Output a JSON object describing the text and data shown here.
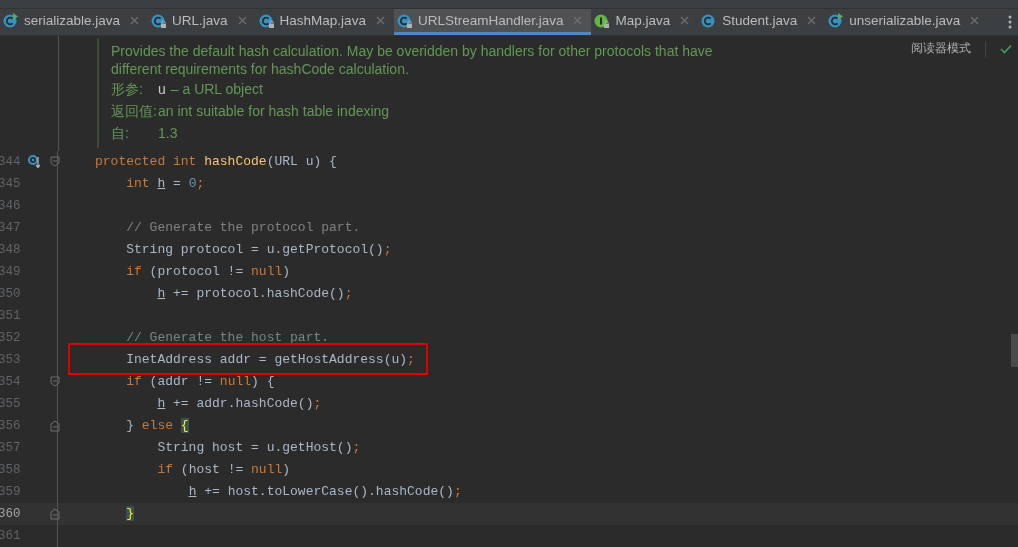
{
  "tabs": [
    {
      "label": "serializable.java",
      "kind": "runnable",
      "selected": false
    },
    {
      "label": "URL.java",
      "kind": "locked",
      "selected": false
    },
    {
      "label": "HashMap.java",
      "kind": "locked",
      "selected": false
    },
    {
      "label": "URLStreamHandler.java",
      "kind": "locked",
      "selected": true
    },
    {
      "label": "Map.java",
      "kind": "interface",
      "selected": false
    },
    {
      "label": "Student.java",
      "kind": "class",
      "selected": false
    },
    {
      "label": "unserializable.java",
      "kind": "runnable",
      "selected": false
    }
  ],
  "doc": {
    "description": [
      "Provides the default hash calculation. May be overidden by handlers for other protocols that have",
      "different requirements for hashCode calculation."
    ],
    "tags": [
      {
        "label": "形参:",
        "name": "u",
        "text": "– a URL object"
      },
      {
        "label": "返回值:",
        "text": "an int suitable for hash table indexing"
      },
      {
        "label": "自:",
        "text": "1.3"
      }
    ],
    "reader_mode": "阅读器模式"
  },
  "lines": [
    {
      "number": "344",
      "overrides": true,
      "fold_start": true,
      "fold_end": false,
      "current": false,
      "highlighted": false,
      "tokens": [
        {
          "kind": "keyword",
          "text": "protected int "
        },
        {
          "kind": "method",
          "text": "hashCode"
        },
        {
          "kind": "plain",
          "text": "(URL u) {"
        }
      ]
    },
    {
      "number": "345",
      "overrides": false,
      "fold_start": false,
      "fold_end": false,
      "current": false,
      "highlighted": false,
      "tokens": [
        {
          "kind": "keyword",
          "text": "    int "
        },
        {
          "kind": "local",
          "text": "h"
        },
        {
          "kind": "plain",
          "text": " = "
        },
        {
          "kind": "number",
          "text": "0"
        },
        {
          "kind": "punct",
          "text": ";"
        }
      ]
    },
    {
      "number": "346",
      "overrides": false,
      "fold_start": false,
      "fold_end": false,
      "current": false,
      "highlighted": false
    },
    {
      "number": "347",
      "overrides": false,
      "fold_start": false,
      "fold_end": false,
      "current": false,
      "highlighted": false,
      "tokens": [
        {
          "kind": "comment",
          "text": "    // Generate the protocol part."
        }
      ]
    },
    {
      "number": "348",
      "overrides": false,
      "fold_start": false,
      "fold_end": false,
      "current": false,
      "highlighted": false,
      "tokens": [
        {
          "kind": "plain",
          "text": "    String protocol = u.getProtocol()"
        },
        {
          "kind": "punct",
          "text": ";"
        }
      ]
    },
    {
      "number": "349",
      "overrides": false,
      "fold_start": false,
      "fold_end": false,
      "current": false,
      "highlighted": false,
      "tokens": [
        {
          "kind": "keyword",
          "text": "    if "
        },
        {
          "kind": "plain",
          "text": "(protocol != "
        },
        {
          "kind": "keyword",
          "text": "null"
        },
        {
          "kind": "plain",
          "text": ")"
        }
      ]
    },
    {
      "number": "350",
      "overrides": false,
      "fold_start": false,
      "fold_end": false,
      "current": false,
      "highlighted": false,
      "tokens": [
        {
          "kind": "local",
          "text": "        h"
        },
        {
          "kind": "plain",
          "text": " += protocol.hashCode()"
        },
        {
          "kind": "punct",
          "text": ";"
        }
      ]
    },
    {
      "number": "351",
      "overrides": false,
      "fold_start": false,
      "fold_end": false,
      "current": false,
      "highlighted": false
    },
    {
      "number": "352",
      "overrides": false,
      "fold_start": false,
      "fold_end": false,
      "current": false,
      "highlighted": false,
      "tokens": [
        {
          "kind": "comment",
          "text": "    // Generate the host part."
        }
      ]
    },
    {
      "number": "353",
      "overrides": false,
      "fold_start": false,
      "fold_end": false,
      "current": false,
      "highlighted": true,
      "tokens": [
        {
          "kind": "plain",
          "text": "    InetAddress addr = getHostAddress(u)"
        },
        {
          "kind": "punct",
          "text": ";"
        }
      ]
    },
    {
      "number": "354",
      "overrides": false,
      "fold_start": true,
      "fold_end": false,
      "current": false,
      "highlighted": false,
      "tokens": [
        {
          "kind": "keyword",
          "text": "    if "
        },
        {
          "kind": "plain",
          "text": "(addr != "
        },
        {
          "kind": "keyword",
          "text": "null"
        },
        {
          "kind": "plain",
          "text": ") {"
        }
      ]
    },
    {
      "number": "355",
      "overrides": false,
      "fold_start": false,
      "fold_end": false,
      "current": false,
      "highlighted": false,
      "tokens": [
        {
          "kind": "local",
          "text": "        h"
        },
        {
          "kind": "plain",
          "text": " += addr.hashCode()"
        },
        {
          "kind": "punct",
          "text": ";"
        }
      ]
    },
    {
      "number": "356",
      "overrides": false,
      "fold_start": true,
      "fold_end": true,
      "current": false,
      "highlighted": false,
      "tokens": [
        {
          "kind": "plain",
          "text": "    } "
        },
        {
          "kind": "keyword",
          "text": "else "
        },
        {
          "kind": "brace_match",
          "text": "{"
        }
      ]
    },
    {
      "number": "357",
      "overrides": false,
      "fold_start": false,
      "fold_end": false,
      "current": false,
      "highlighted": false,
      "tokens": [
        {
          "kind": "plain",
          "text": "        String host = u.getHost()"
        },
        {
          "kind": "punct",
          "text": ";"
        }
      ]
    },
    {
      "number": "358",
      "overrides": false,
      "fold_start": false,
      "fold_end": false,
      "current": false,
      "highlighted": false,
      "tokens": [
        {
          "kind": "keyword",
          "text": "        if "
        },
        {
          "kind": "plain",
          "text": "(host != "
        },
        {
          "kind": "keyword",
          "text": "null"
        },
        {
          "kind": "plain",
          "text": ")"
        }
      ]
    },
    {
      "number": "359",
      "overrides": false,
      "fold_start": false,
      "fold_end": false,
      "current": false,
      "highlighted": false,
      "tokens": [
        {
          "kind": "local",
          "text": "            h"
        },
        {
          "kind": "plain",
          "text": " += host.toLowerCase().hashCode()"
        },
        {
          "kind": "punct",
          "text": ";"
        }
      ]
    },
    {
      "number": "360",
      "overrides": false,
      "fold_start": false,
      "fold_end": true,
      "current": true,
      "highlighted": false,
      "tokens": [
        {
          "kind": "brace_match",
          "text": "    }"
        }
      ]
    },
    {
      "number": "361",
      "overrides": false,
      "fold_start": false,
      "fold_end": false,
      "current": false,
      "highlighted": false
    }
  ]
}
